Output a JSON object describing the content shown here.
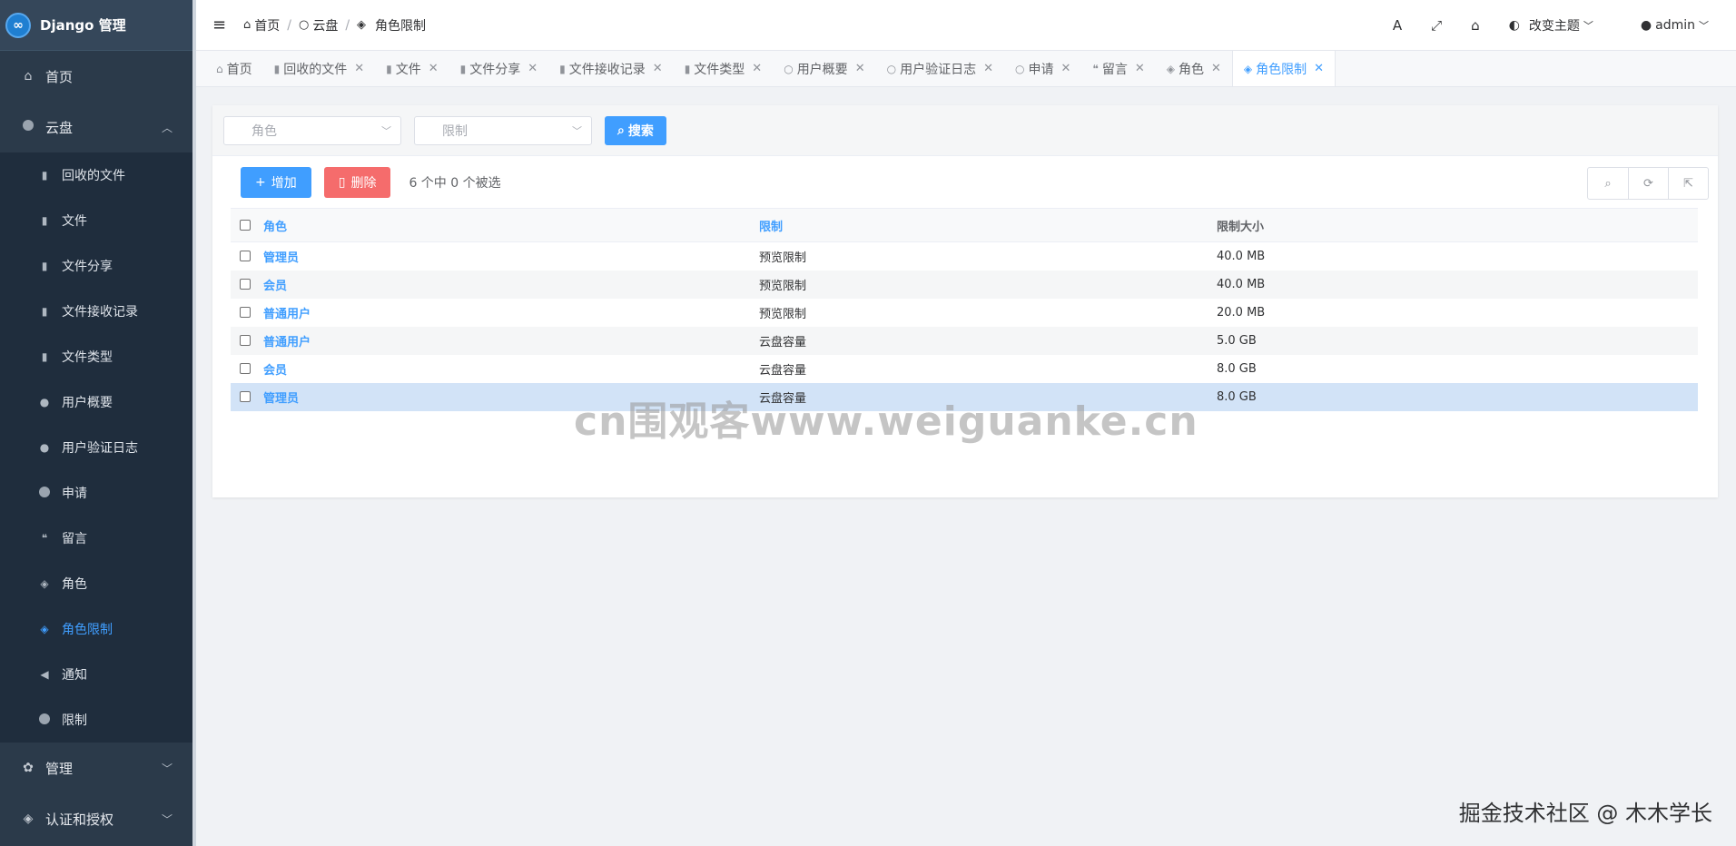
{
  "brand": {
    "logo": "∞",
    "title": "Django 管理"
  },
  "sidebar": {
    "home": {
      "icon": "home-icon",
      "label": "首页"
    },
    "cloud": {
      "icon": "circle-icon",
      "label": "云盘"
    },
    "cloud_items": [
      {
        "icon": "file-icon",
        "label": "回收的文件"
      },
      {
        "icon": "file-icon",
        "label": "文件"
      },
      {
        "icon": "file-icon",
        "label": "文件分享"
      },
      {
        "icon": "file-icon",
        "label": "文件接收记录"
      },
      {
        "icon": "file-icon",
        "label": "文件类型"
      },
      {
        "icon": "user-icon",
        "label": "用户概要"
      },
      {
        "icon": "user-icon",
        "label": "用户验证日志"
      },
      {
        "icon": "circle-icon",
        "label": "申请"
      },
      {
        "icon": "comments-icon",
        "label": "留言"
      },
      {
        "icon": "shield-icon",
        "label": "角色"
      },
      {
        "icon": "shield-icon",
        "label": "角色限制"
      },
      {
        "icon": "megaphone-icon",
        "label": "通知"
      },
      {
        "icon": "circle-icon",
        "label": "限制"
      }
    ],
    "manage": {
      "icon": "gear-icon",
      "label": "管理"
    },
    "auth": {
      "icon": "shield-icon",
      "label": "认证和授权"
    }
  },
  "header": {
    "breadcrumb": [
      "首页",
      "云盘",
      "角色限制"
    ],
    "theme_label": "改变主题",
    "user_label": "admin"
  },
  "tabs": [
    "首页",
    "回收的文件",
    "文件",
    "文件分享",
    "文件接收记录",
    "文件类型",
    "用户概要",
    "用户验证日志",
    "申请",
    "留言",
    "角色",
    "角色限制"
  ],
  "filters": {
    "role_placeholder": "角色",
    "limit_placeholder": "限制",
    "search_label": "搜索"
  },
  "actions": {
    "add_label": "增加",
    "delete_label": "删除",
    "selection_text": "6 个中 0 个被选"
  },
  "table": {
    "headers": [
      "角色",
      "限制",
      "限制大小"
    ],
    "rows": [
      [
        "管理员",
        "预览限制",
        "40.0 MB"
      ],
      [
        "会员",
        "预览限制",
        "40.0 MB"
      ],
      [
        "普通用户",
        "预览限制",
        "20.0 MB"
      ],
      [
        "普通用户",
        "云盘容量",
        "5.0 GB"
      ],
      [
        "会员",
        "云盘容量",
        "8.0 GB"
      ],
      [
        "管理员",
        "云盘容量",
        "8.0 GB"
      ]
    ]
  },
  "watermark": "cn围观客www.weiguanke.cn",
  "footer_mark": "掘金技术社区 @ 木木学长"
}
